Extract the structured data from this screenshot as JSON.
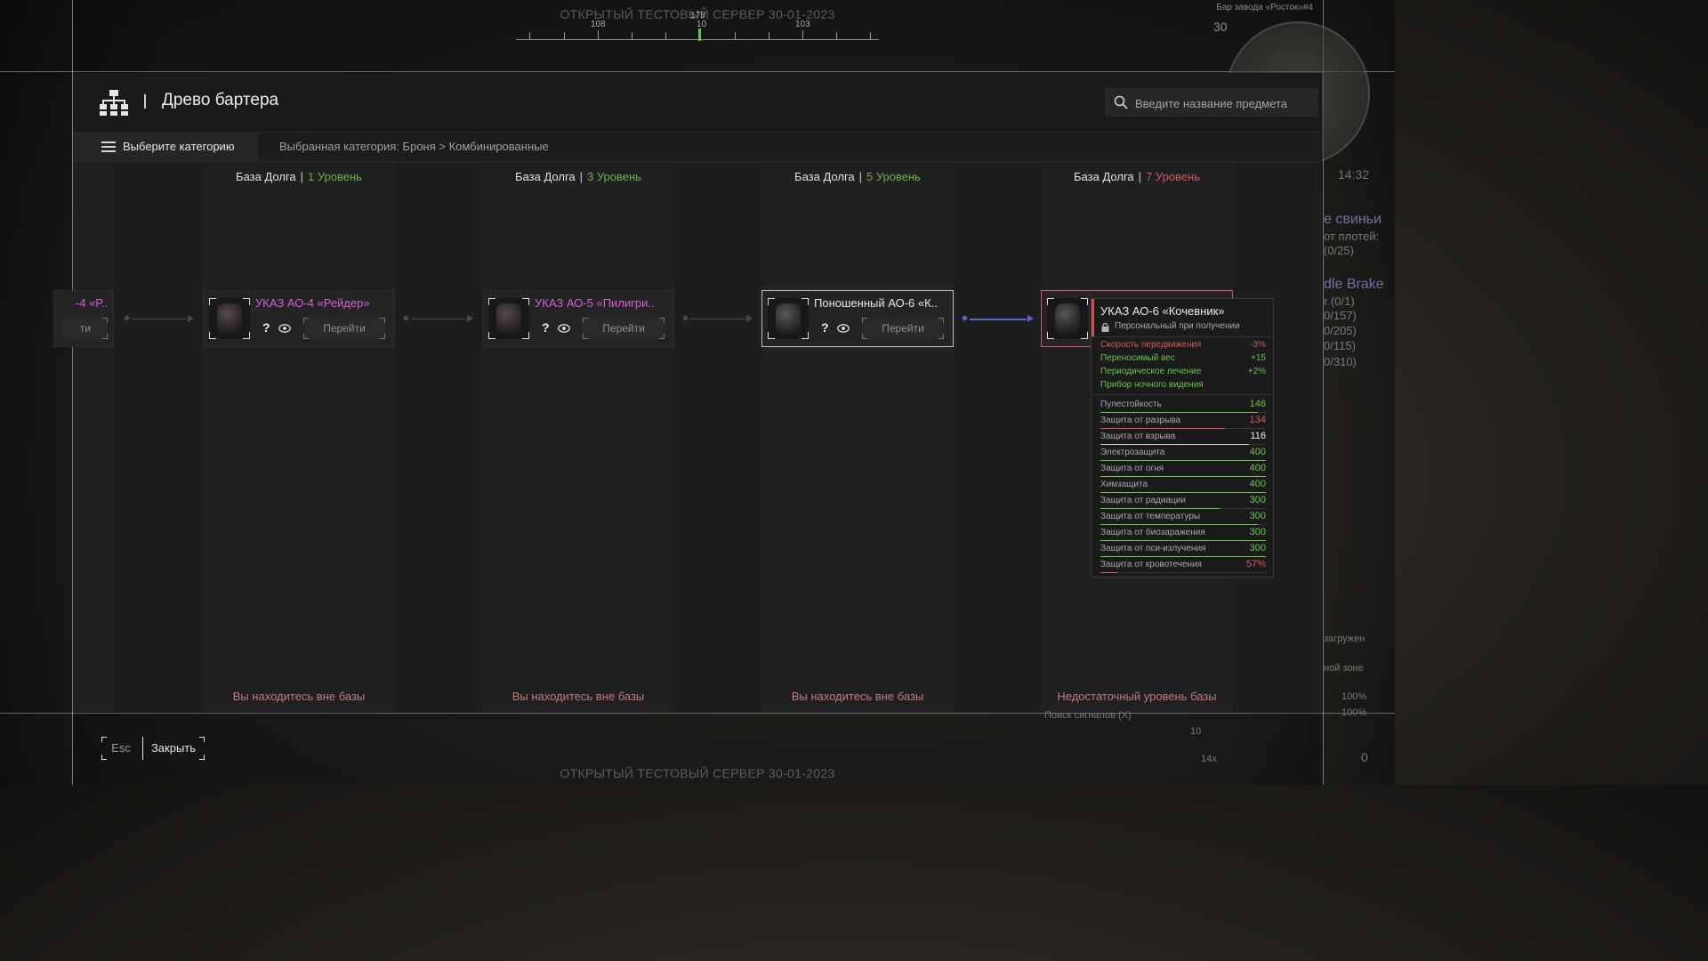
{
  "hud": {
    "server_watermark": "ОТКРЫТЫЙ ТЕСТОВЫЙ СЕРВЕР 30-01-2023",
    "compass": {
      "labels": [
        "108",
        "178",
        "10",
        "103"
      ]
    },
    "location": "Бар завода «Росток»#4",
    "counter_30": "30",
    "time": "14:32",
    "side_texts": [
      "е свиньи",
      "от плотей:",
      "(0/25)",
      "dle Brake",
      "r (0/1)",
      "0/157)",
      "0/205)",
      "0/115)",
      "0/310)",
      "загружен",
      "ной зоне",
      "100%",
      "100%"
    ],
    "signal_search": "Поиск сигналов (X)",
    "ammo": "10",
    "zoom": "14x",
    "grenades": "0"
  },
  "header": {
    "title": "Древо бартера",
    "search_placeholder": "Введите название предмета"
  },
  "category": {
    "button_label": "Выберите категорию",
    "selected_path": "Выбранная категория: Броня > Комбинированные"
  },
  "columns": [
    {
      "base": "База Долга",
      "level": "1 Уровень",
      "footer": "Вы находитесь вне базы",
      "item": {
        "name": "УКАЗ АО-4 «Рейдер»",
        "goto": "Перейти"
      }
    },
    {
      "base": "База Долга",
      "level": "3 Уровень",
      "footer": "Вы находитесь вне базы",
      "item": {
        "name": "УКАЗ АО-5 «Пилигри..",
        "goto": "Перейти"
      }
    },
    {
      "base": "База Долга",
      "level": "5 Уровень",
      "footer": "Вы находитесь вне базы",
      "item": {
        "name": "Поношенный АО-6 «К..",
        "goto": "Перейти"
      }
    },
    {
      "base": "База Долга",
      "level": "7 Уровень",
      "footer": "Недостаточный уровень базы",
      "item": {
        "name": "УКАЗ АО-6 «Кочевник»"
      }
    }
  ],
  "partial_item": {
    "name": "-4 «Р..",
    "goto": "ти"
  },
  "tooltip": {
    "name": "УКАЗ АО-6 «Кочевник»",
    "personal": "Персональный при получении",
    "effects": [
      {
        "name": "Скорость передвижения",
        "value": "-3%",
        "tone": "red"
      },
      {
        "name": "Переносимый вес",
        "value": "+15",
        "tone": "green"
      },
      {
        "name": "Периодическое лечение",
        "value": "+2%",
        "tone": "green"
      },
      {
        "name": "Прибор ночного видения",
        "value": "",
        "tone": "green"
      }
    ],
    "stats": [
      {
        "name": "Пулестойкость",
        "value": "146",
        "tone": "g",
        "fill": 0.95
      },
      {
        "name": "Защита от разрыва",
        "value": "134",
        "tone": "r",
        "fill": 0.75
      },
      {
        "name": "Защита от взрыва",
        "value": "116",
        "tone": "w",
        "fill": 0.9
      },
      {
        "name": "Электрозащита",
        "value": "400",
        "tone": "g",
        "fill": 1
      },
      {
        "name": "Защита от огня",
        "value": "400",
        "tone": "g",
        "fill": 1
      },
      {
        "name": "Химзащита",
        "value": "400",
        "tone": "g",
        "fill": 1
      },
      {
        "name": "Защита от радиации",
        "value": "300",
        "tone": "g",
        "fill": 0.72
      },
      {
        "name": "Защита от температуры",
        "value": "300",
        "tone": "g",
        "fill": 0.95
      },
      {
        "name": "Защита от биозаражения",
        "value": "300",
        "tone": "g",
        "fill": 1
      },
      {
        "name": "Защита от пси-излучения",
        "value": "300",
        "tone": "g",
        "fill": 1
      },
      {
        "name": "Защита от кровотечения",
        "value": "57%",
        "tone": "r",
        "fill": 0.1
      }
    ]
  },
  "footer": {
    "esc": "Esc",
    "close": "Закрыть"
  }
}
